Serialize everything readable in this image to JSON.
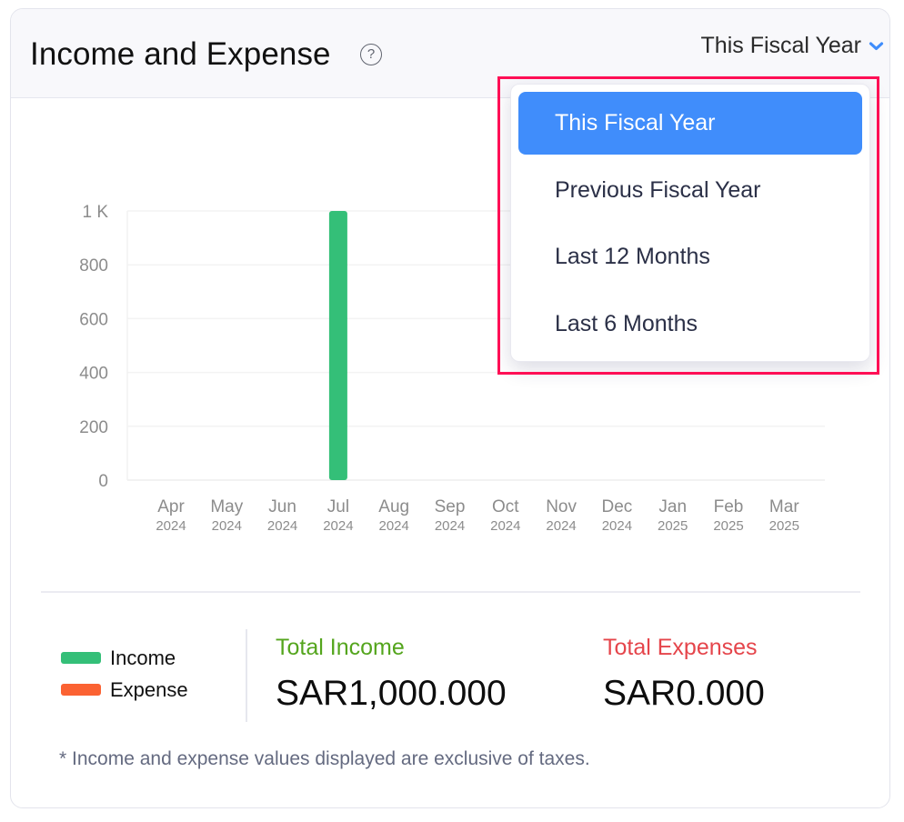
{
  "widget": {
    "title": "Income and Expense",
    "help_icon": "question-circle-icon",
    "period_selector": {
      "selected": "This Fiscal Year",
      "icon": "chevron-down-icon",
      "accent_color": "#408dfb",
      "open": true,
      "options": [
        {
          "label": "This Fiscal Year",
          "selected": true
        },
        {
          "label": "Previous Fiscal Year",
          "selected": false
        },
        {
          "label": "Last 12 Months",
          "selected": false
        },
        {
          "label": "Last 6 Months",
          "selected": false
        }
      ]
    }
  },
  "chart_data": {
    "type": "bar",
    "title": "",
    "xlabel": "",
    "ylabel": "",
    "ylim": [
      0,
      1000
    ],
    "grid": true,
    "y_ticks": [
      0,
      200,
      400,
      600,
      800,
      1000
    ],
    "y_tick_labels": [
      "0",
      "200",
      "400",
      "600",
      "800",
      "1 K"
    ],
    "categories": [
      {
        "month": "Apr",
        "year": "2024"
      },
      {
        "month": "May",
        "year": "2024"
      },
      {
        "month": "Jun",
        "year": "2024"
      },
      {
        "month": "Jul",
        "year": "2024"
      },
      {
        "month": "Aug",
        "year": "2024"
      },
      {
        "month": "Sep",
        "year": "2024"
      },
      {
        "month": "Oct",
        "year": "2024"
      },
      {
        "month": "Nov",
        "year": "2024"
      },
      {
        "month": "Dec",
        "year": "2024"
      },
      {
        "month": "Jan",
        "year": "2025"
      },
      {
        "month": "Feb",
        "year": "2025"
      },
      {
        "month": "Mar",
        "year": "2025"
      }
    ],
    "series": [
      {
        "name": "Income",
        "color": "#34bf78",
        "values": [
          0,
          0,
          0,
          1000,
          0,
          0,
          0,
          0,
          0,
          0,
          0,
          0
        ]
      },
      {
        "name": "Expense",
        "color": "#fb6232",
        "values": [
          0,
          0,
          0,
          0,
          0,
          0,
          0,
          0,
          0,
          0,
          0,
          0
        ]
      }
    ],
    "legend_position": "bottom-left"
  },
  "legend": [
    {
      "label": "Income",
      "color": "#34bf78"
    },
    {
      "label": "Expense",
      "color": "#fb6232"
    }
  ],
  "totals": {
    "income": {
      "label": "Total Income",
      "value": "SAR1,000.000",
      "color": "#54a51d"
    },
    "expense": {
      "label": "Total Expenses",
      "value": "SAR0.000",
      "color": "#e5454b"
    }
  },
  "footnote": "* Income and expense values displayed are exclusive of taxes."
}
